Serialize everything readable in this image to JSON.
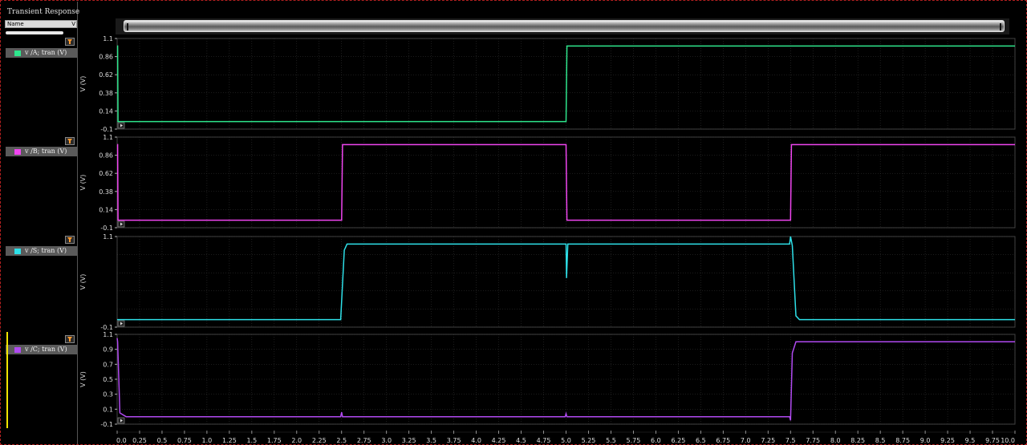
{
  "window": {
    "title": "Transient Response",
    "name_column": "Name",
    "name_column_tail": "V"
  },
  "colors": {
    "background": "#000000",
    "grid": "#3a3a3a",
    "axis": "#b0b0b0",
    "trace_A": "#2ee68c",
    "trace_B": "#f045f0",
    "trace_S": "#2ee0e8",
    "trace_C": "#b04af0"
  },
  "traces": [
    {
      "label": "v /A; tran (V)",
      "color": "#2ee68c"
    },
    {
      "label": "v /B; tran (V)",
      "color": "#f045f0"
    },
    {
      "label": "v /S; tran (V)",
      "color": "#2ee0e8"
    },
    {
      "label": "v /C; tran (V)",
      "color": "#b04af0"
    }
  ],
  "chart_data": [
    {
      "type": "line",
      "series": [
        {
          "name": "v /A; tran (V)",
          "x": [
            0,
            0.005,
            0.01,
            5.0,
            5.01,
            10.0
          ],
          "y": [
            1.0,
            1.0,
            0.0,
            0.0,
            1.0,
            1.0
          ]
        }
      ],
      "ylabel": "V (V)",
      "yticks": [
        "1.1",
        "0.86",
        "0.62",
        "0.38",
        "0.14",
        "-0.1"
      ],
      "ylim": [
        -0.1,
        1.1
      ],
      "xlim": [
        0,
        10
      ]
    },
    {
      "type": "line",
      "series": [
        {
          "name": "v /B; tran (V)",
          "x": [
            0,
            0.005,
            0.01,
            2.5,
            2.51,
            5.0,
            5.01,
            7.5,
            7.51,
            10.0
          ],
          "y": [
            1.0,
            1.0,
            0.0,
            0.0,
            1.0,
            1.0,
            0.0,
            0.0,
            1.0,
            1.0
          ]
        }
      ],
      "ylabel": "V (V)",
      "yticks": [
        "1.1",
        "0.86",
        "0.62",
        "0.38",
        "0.14",
        "-0.1"
      ],
      "ylim": [
        -0.1,
        1.1
      ],
      "xlim": [
        0,
        10
      ]
    },
    {
      "type": "line",
      "series": [
        {
          "name": "v /S; tran (V)",
          "x": [
            0,
            2.49,
            2.53,
            2.56,
            5.0,
            5.005,
            5.02,
            5.04,
            7.49,
            7.5,
            7.52,
            7.56,
            7.6,
            10.0
          ],
          "y": [
            0.0,
            0.0,
            0.92,
            1.0,
            1.0,
            0.55,
            1.0,
            1.0,
            1.0,
            1.1,
            0.98,
            0.05,
            0.0,
            0.0
          ]
        }
      ],
      "ylabel": "V (V)",
      "yticks": [
        "1.1",
        "-0.1"
      ],
      "ylim": [
        -0.1,
        1.1
      ],
      "xlim": [
        0,
        10
      ]
    },
    {
      "type": "line",
      "series": [
        {
          "name": "v /C; tran (V)",
          "x": [
            0,
            0.005,
            0.03,
            0.1,
            2.49,
            2.5,
            2.51,
            4.99,
            5.0,
            5.01,
            7.49,
            7.5,
            7.52,
            7.56,
            7.6,
            10.0
          ],
          "y": [
            1.05,
            1.0,
            0.05,
            0.0,
            0.0,
            0.06,
            0.0,
            0.0,
            0.04,
            0.0,
            0.0,
            -0.05,
            0.85,
            1.0,
            1.0,
            1.0
          ]
        }
      ],
      "ylabel": "V (V)",
      "yticks": [
        "1.1",
        "0.9",
        "0.7",
        "0.5",
        "0.3",
        "0.1",
        "-0.1"
      ],
      "ylim": [
        -0.1,
        1.1
      ],
      "xlim": [
        0,
        10
      ]
    }
  ],
  "x_axis": {
    "ticks": [
      "0.0",
      "0.25",
      "0.5",
      "0.75",
      "1.0",
      "1.25",
      "1.5",
      "1.75",
      "2.0",
      "2.25",
      "2.5",
      "2.75",
      "3.0",
      "3.25",
      "3.5",
      "3.75",
      "4.0",
      "4.25",
      "4.5",
      "4.75",
      "5.0",
      "5.25",
      "5.5",
      "5.75",
      "6.0",
      "6.25",
      "6.5",
      "6.75",
      "7.0",
      "7.25",
      "7.5",
      "7.75",
      "8.0",
      "8.25",
      "8.5",
      "8.75",
      "9.0",
      "9.25",
      "9.5",
      "9.75",
      "10.0"
    ]
  }
}
